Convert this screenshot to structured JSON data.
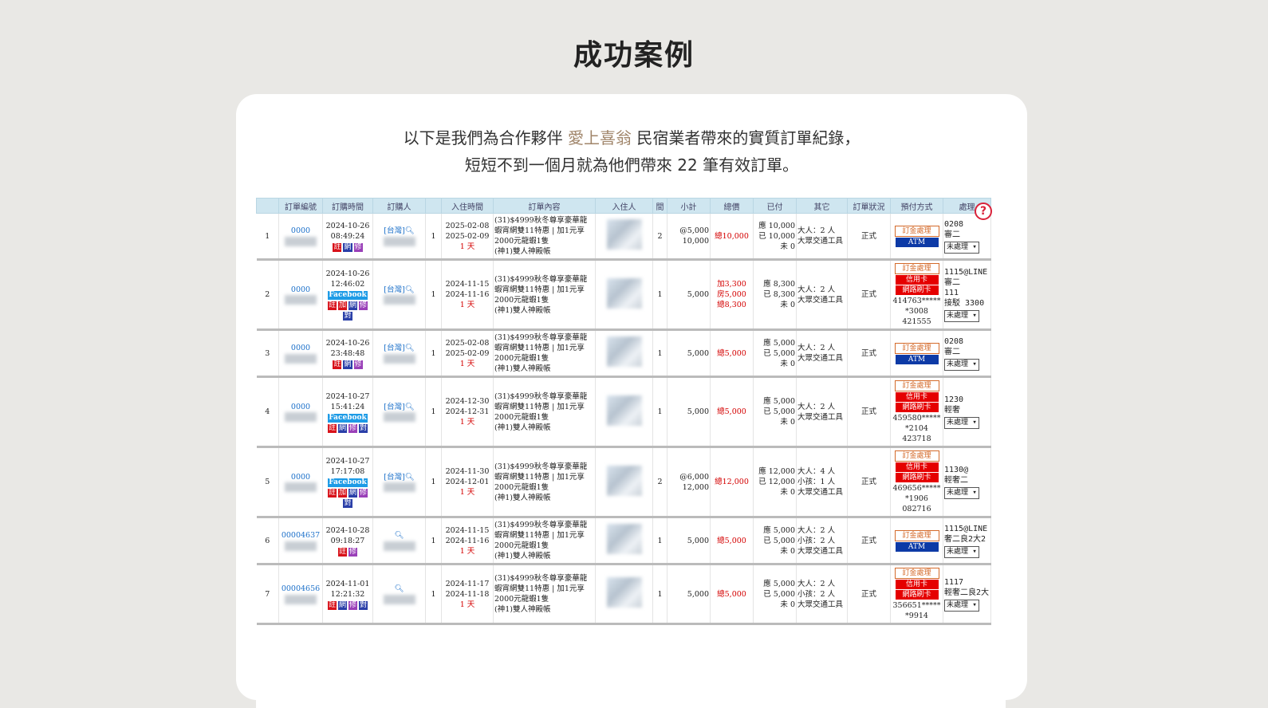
{
  "page": {
    "title": "成功案例"
  },
  "intro": {
    "line1_before": "以下是我們為合作夥伴",
    "partner": "愛上喜翁",
    "line1_after": "民宿業者帶來的實質訂單紀錄，",
    "line2": "短短不到一個月就為他們帶來 22 筆有效訂單。"
  },
  "table": {
    "headers": [
      "",
      "訂單編號",
      "訂購時間",
      "訂購人",
      "",
      "入住時間",
      "訂單內容",
      "入住人",
      "間",
      "小計",
      "總價",
      "已付",
      "其它",
      "訂單狀況",
      "預付方式",
      "處理"
    ],
    "rows": [
      {
        "idx": "1",
        "order_no": "0000",
        "time1": "2024-10-26",
        "time2": "08:49:24",
        "fb": "",
        "tags": [
          "註",
          "網",
          "修"
        ],
        "buyer": "[台灣]",
        "qty": "1",
        "checkin": "2025-02-08",
        "checkout": "2025-02-09",
        "nights": "1 天",
        "content": "(31)$4999秋冬尊享豪華龍蝦宵網雙11特惠 | 加1元享2000元龍蝦1隻\n(神1)雙人神殿帳",
        "rooms": "2",
        "subtotal": "@5,000\n10,000",
        "total": "總10,000",
        "paid": "應 10,000\n已 10,000\n未 0",
        "other": "大人：2 人\n大眾交通工具",
        "status": "正式",
        "pay": [
          "訂金處理",
          "ATM"
        ],
        "card_info": "",
        "note": "0208\n審二",
        "select": "未處理"
      },
      {
        "idx": "2",
        "order_no": "0000",
        "time1": "2024-10-26",
        "time2": "12:46:02",
        "fb": "Facebook",
        "tags": [
          "註",
          "加",
          "網",
          "修",
          "對"
        ],
        "buyer": "[台灣]",
        "qty": "1",
        "checkin": "2024-11-15",
        "checkout": "2024-11-16",
        "nights": "1 天",
        "content": "(31)$4999秋冬尊享豪華龍蝦宵網雙11特惠 | 加1元享2000元龍蝦1隻\n(神1)雙人神殿帳",
        "rooms": "1",
        "subtotal": "5,000",
        "total": "加3,300\n房5,000\n總8,300",
        "paid": "應 8,300\n已 8,300\n未 0",
        "other": "大人：2 人\n大眾交通工具",
        "status": "正式",
        "pay": [
          "訂金處理",
          "信用卡",
          "網路刷卡"
        ],
        "card_info": "414763*****\n*3008\n421555",
        "note": "1115@LINE\n審二\n111\n接駁 3300",
        "select": "未處理"
      },
      {
        "idx": "3",
        "order_no": "0000",
        "time1": "2024-10-26",
        "time2": "23:48:48",
        "fb": "",
        "tags": [
          "註",
          "網",
          "修"
        ],
        "buyer": "[台灣]",
        "qty": "1",
        "checkin": "2025-02-08",
        "checkout": "2025-02-09",
        "nights": "1 天",
        "content": "(31)$4999秋冬尊享豪華龍蝦宵網雙11特惠 | 加1元享2000元龍蝦1隻\n(神1)雙人神殿帳",
        "rooms": "1",
        "subtotal": "5,000",
        "total": "總5,000",
        "paid": "應 5,000\n已 5,000\n未 0",
        "other": "大人：2 人\n大眾交通工具",
        "status": "正式",
        "pay": [
          "訂金處理",
          "ATM"
        ],
        "card_info": "",
        "note": "0208\n審二",
        "select": "未處理"
      },
      {
        "idx": "4",
        "order_no": "0000",
        "time1": "2024-10-27",
        "time2": "15:41:24",
        "fb": "Facebook",
        "tags": [
          "註",
          "網",
          "修",
          "對"
        ],
        "buyer": "[台灣]",
        "qty": "1",
        "checkin": "2024-12-30",
        "checkout": "2024-12-31",
        "nights": "1 天",
        "content": "(31)$4999秋冬尊享豪華龍蝦宵網雙11特惠 | 加1元享2000元龍蝦1隻\n(神1)雙人神殿帳",
        "rooms": "1",
        "subtotal": "5,000",
        "total": "總5,000",
        "paid": "應 5,000\n已 5,000\n未 0",
        "other": "大人：2 人\n大眾交通工具",
        "status": "正式",
        "pay": [
          "訂金處理",
          "信用卡",
          "網路刷卡"
        ],
        "card_info": "459580*****\n*2104\n423718",
        "note": "1230\n輕奢",
        "select": "未處理"
      },
      {
        "idx": "5",
        "order_no": "0000",
        "time1": "2024-10-27",
        "time2": "17:17:08",
        "fb": "Facebook",
        "tags": [
          "註",
          "加",
          "網",
          "修",
          "對"
        ],
        "buyer": "[台灣]",
        "qty": "1",
        "checkin": "2024-11-30",
        "checkout": "2024-12-01",
        "nights": "1 天",
        "content": "(31)$4999秋冬尊享豪華龍蝦宵網雙11特惠 | 加1元享2000元龍蝦1隻\n(神1)雙人神殿帳",
        "rooms": "2",
        "subtotal": "@6,000\n12,000",
        "total": "總12,000",
        "paid": "應 12,000\n已 12,000\n未 0",
        "other": "大人：4 人\n小孩：1 人\n大眾交通工具",
        "status": "正式",
        "pay": [
          "訂金處理",
          "信用卡",
          "網路刷卡"
        ],
        "card_info": "469656*****\n*1906\n082716",
        "note": "1130@\n輕奢二",
        "select": "未處理"
      },
      {
        "idx": "6",
        "order_no": "00004637",
        "time1": "2024-10-28",
        "time2": "09:18:27",
        "fb": "",
        "tags": [
          "註",
          "修"
        ],
        "buyer": "",
        "qty": "1",
        "checkin": "2024-11-15",
        "checkout": "2024-11-16",
        "nights": "1 天",
        "content": "(31)$4999秋冬尊享豪華龍蝦宵網雙11特惠 | 加1元享2000元龍蝦1隻\n(神1)雙人神殿帳",
        "rooms": "1",
        "subtotal": "5,000",
        "total": "總5,000",
        "paid": "應 5,000\n已 5,000\n未 0",
        "other": "大人：2 人\n小孩：2 人\n大眾交通工具",
        "status": "正式",
        "pay": [
          "訂金處理",
          "ATM"
        ],
        "card_info": "",
        "note": "1115@LINE\n奢二良2大2",
        "select": "未處理"
      },
      {
        "idx": "7",
        "order_no": "00004656",
        "time1": "2024-11-01",
        "time2": "12:21:32",
        "fb": "",
        "tags": [
          "註",
          "網",
          "修",
          "對"
        ],
        "buyer": "",
        "qty": "1",
        "checkin": "2024-11-17",
        "checkout": "2024-11-18",
        "nights": "1 天",
        "content": "(31)$4999秋冬尊享豪華龍蝦宵網雙11特惠 | 加1元享2000元龍蝦1隻\n(神1)雙人神殿帳",
        "rooms": "1",
        "subtotal": "5,000",
        "total": "總5,000",
        "paid": "應 5,000\n已 5,000\n未 0",
        "other": "大人：2 人\n小孩：2 人\n大眾交通工具",
        "status": "正式",
        "pay": [
          "訂金處理",
          "信用卡",
          "網路刷卡"
        ],
        "card_info": "356651*****\n*9914",
        "note": "1117\n輕奢二良2大",
        "select": "未處理"
      }
    ]
  },
  "help_icon": "question-circle-icon",
  "colors": {
    "background": "#e9e8e5",
    "card": "#ffffff",
    "partner": "#a0856a",
    "header": "#cfe6f0",
    "link": "#1a6fc9"
  }
}
